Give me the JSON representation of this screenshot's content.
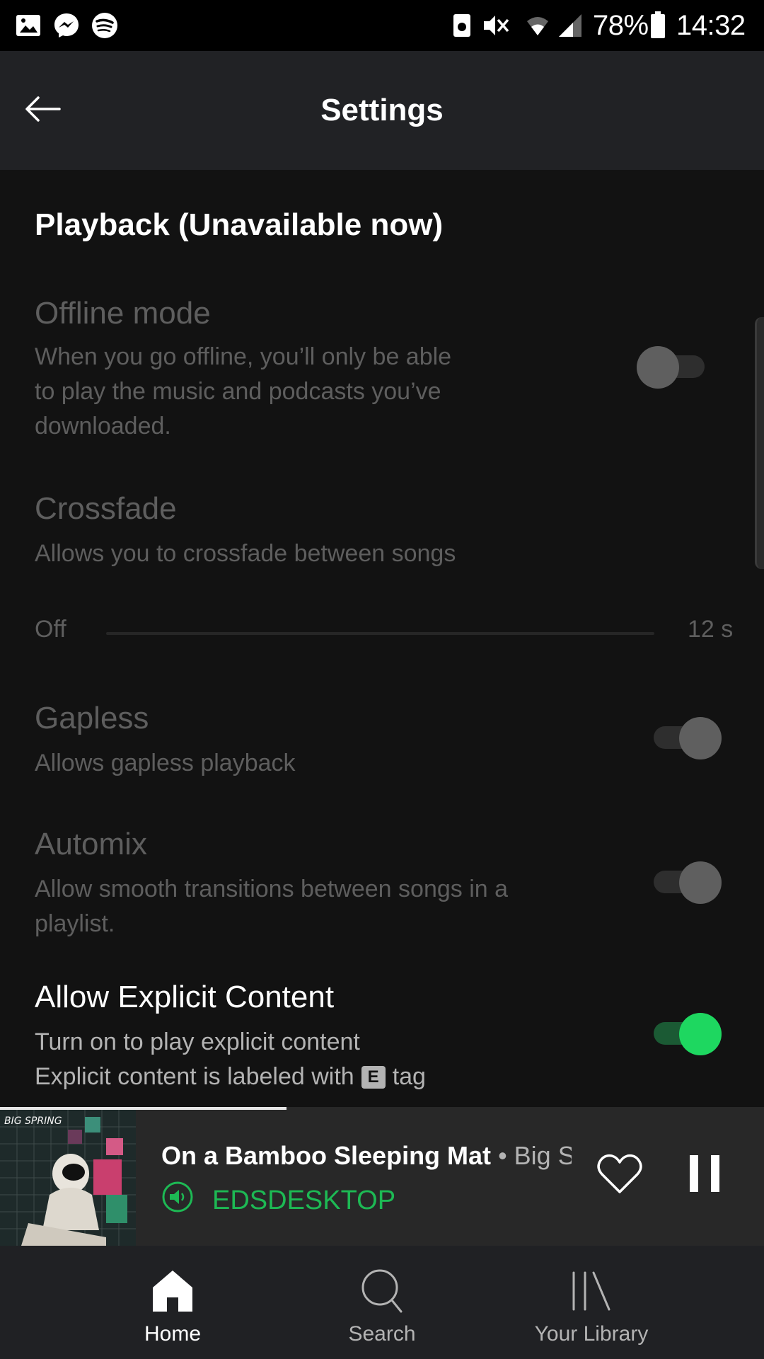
{
  "status_bar": {
    "battery_percent": "78%",
    "time": "14:32",
    "left_icons": [
      "gallery-icon",
      "messenger-icon",
      "spotify-icon"
    ],
    "right_icons": [
      "storage-icon",
      "mute-icon",
      "wifi-icon",
      "signal-icon",
      "battery-icon"
    ]
  },
  "header": {
    "title": "Settings",
    "back_icon": "arrow-left-icon"
  },
  "playback": {
    "section_title": "Playback (Unavailable now)",
    "offline_mode": {
      "title": "Offline mode",
      "description": [
        "When you go offline, you’ll only be able",
        "to play the music and podcasts you’ve",
        "downloaded."
      ],
      "toggle_on": false
    },
    "crossfade": {
      "title": "Crossfade",
      "description": "Allows you to crossfade between songs",
      "min_label": "Off",
      "max_label": "12 s",
      "value_seconds": 0
    },
    "gapless": {
      "title": "Gapless",
      "description": "Allows gapless playback",
      "toggle_on": true
    },
    "automix": {
      "title": "Automix",
      "description": [
        "Allow smooth transitions between songs in a",
        "playlist."
      ],
      "toggle_on": true
    },
    "explicit": {
      "title": "Allow Explicit Content",
      "description_line1": "Turn on to play explicit content",
      "description_line2_pre": "Explicit content is labeled with",
      "badge": "E",
      "description_line2_post": "tag",
      "toggle_on": true
    }
  },
  "mini_player": {
    "track": "On a Bamboo Sleeping Mat",
    "separator": "•",
    "artist": "Big Spring",
    "album_art_text": "BIG SPRING",
    "device": "EDSDESKTOP",
    "progress": 0.375,
    "icons": [
      "speaker-icon",
      "heart-icon",
      "pause-icon"
    ]
  },
  "nav": {
    "items": [
      {
        "label": "Home",
        "icon": "home-icon",
        "active": true
      },
      {
        "label": "Search",
        "icon": "search-icon",
        "active": false
      },
      {
        "label": "Your Library",
        "icon": "library-icon",
        "active": false
      }
    ]
  },
  "colors": {
    "accent": "#1db954",
    "toggle_active": "#1ed760"
  }
}
